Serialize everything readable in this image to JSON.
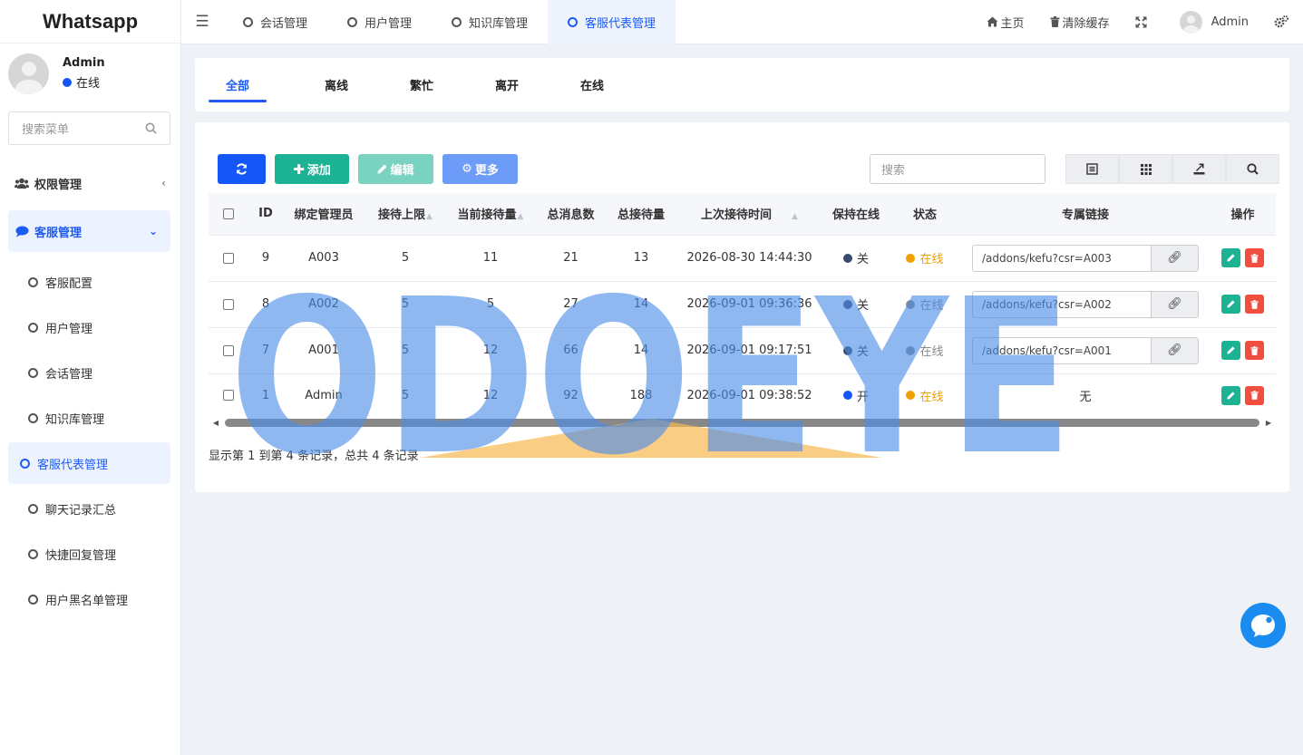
{
  "app": {
    "title": "Whatsapp"
  },
  "user": {
    "name": "Admin",
    "status": "在线",
    "status_color": "#1556f6"
  },
  "sidebar": {
    "search_placeholder": "搜索菜单",
    "groups": [
      {
        "label": "权限管理",
        "icon": "users-icon"
      },
      {
        "label": "客服管理",
        "icon": "comment-icon"
      }
    ],
    "items": [
      {
        "label": "客服配置"
      },
      {
        "label": "用户管理"
      },
      {
        "label": "会话管理"
      },
      {
        "label": "知识库管理"
      },
      {
        "label": "客服代表管理"
      },
      {
        "label": "聊天记录汇总"
      },
      {
        "label": "快捷回复管理"
      },
      {
        "label": "用户黑名单管理"
      }
    ]
  },
  "topbar": {
    "tabs": [
      {
        "label": "会话管理"
      },
      {
        "label": "用户管理"
      },
      {
        "label": "知识库管理"
      },
      {
        "label": "客服代表管理"
      }
    ],
    "home": "主页",
    "clear_cache": "清除缓存",
    "admin": "Admin"
  },
  "filter_tabs": [
    "全部",
    "离线",
    "繁忙",
    "离开",
    "在线"
  ],
  "toolbar": {
    "add": "添加",
    "edit": "编辑",
    "more": "更多",
    "search_placeholder": "搜索"
  },
  "table": {
    "headers": [
      "ID",
      "绑定管理员",
      "接待上限",
      "当前接待量",
      "总消息数",
      "总接待量",
      "上次接待时间",
      "保持在线",
      "状态",
      "专属链接",
      "操作"
    ],
    "rows": [
      {
        "id": "9",
        "admin": "A003",
        "limit": "5",
        "current": "11",
        "messages": "21",
        "total": "13",
        "last_time": "2026-08-30 14:44:30",
        "keep": "关",
        "keep_color": "#3a4a6b",
        "status": "在线",
        "status_color": "#f0a000",
        "link": "/addons/kefu?csr=A003"
      },
      {
        "id": "8",
        "admin": "A002",
        "limit": "5",
        "current": "5",
        "messages": "27",
        "total": "14",
        "last_time": "2026-09-01 09:36:36",
        "keep": "关",
        "keep_color": "#3a4a6b",
        "status": "在线",
        "status_color": "#8a8a8a",
        "link": "/addons/kefu?csr=A002"
      },
      {
        "id": "7",
        "admin": "A001",
        "limit": "5",
        "current": "12",
        "messages": "66",
        "total": "14",
        "last_time": "2026-09-01 09:17:51",
        "keep": "关",
        "keep_color": "#3a4a6b",
        "status": "在线",
        "status_color": "#8a8a8a",
        "link": "/addons/kefu?csr=A001"
      },
      {
        "id": "1",
        "admin": "Admin",
        "limit": "5",
        "current": "12",
        "messages": "92",
        "total": "188",
        "last_time": "2026-09-01 09:38:52",
        "keep": "开",
        "keep_color": "#1556f6",
        "status": "在线",
        "status_color": "#f0a000",
        "link": "无"
      }
    ]
  },
  "pager": {
    "info": "显示第 1 到第 4 条记录，总共 4 条记录"
  },
  "watermark": {
    "text": "ODOEYE"
  }
}
